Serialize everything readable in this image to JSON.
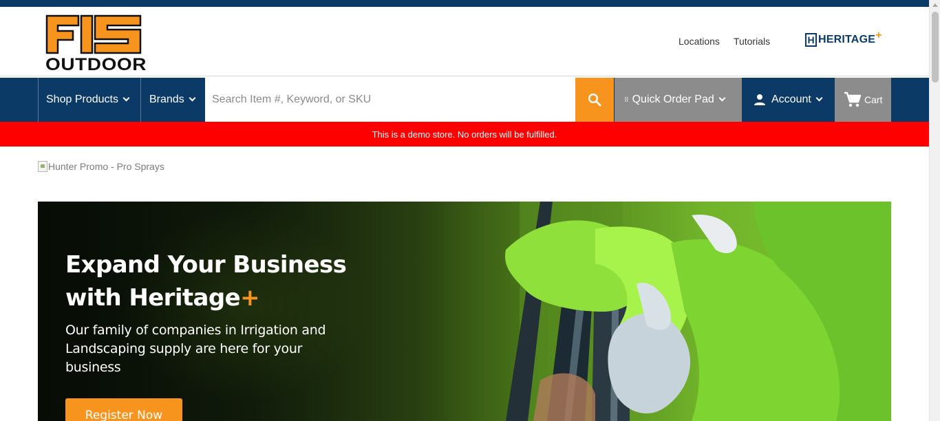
{
  "header": {
    "brand_logo_word": "FIS",
    "brand_logo_sub": "OUTDOOR",
    "top_links": [
      "Locations",
      "Tutorials"
    ],
    "partner_logo": {
      "word": "HERITAGE",
      "plus": "+"
    }
  },
  "nav": {
    "shop_products": "Shop Products",
    "brands": "Brands",
    "search": {
      "placeholder": "Search Item #, Keyword, or SKU",
      "value": ""
    },
    "quick_order_pad": "Quick Order Pad",
    "account": "Account",
    "cart": "Cart"
  },
  "notice": "This is a demo store. No orders will be fulfilled.",
  "promo_alt": "Hunter Promo - Pro Sprays",
  "hero": {
    "title_line1": "Expand Your Business",
    "title_line2": "with Heritage",
    "title_plus": "+",
    "subtitle": "Our family of companies in Irrigation and Landscaping supply are here for your business",
    "cta": "Register Now"
  },
  "colors": {
    "brand_navy": "#0b3a66",
    "accent_orange": "#f7941d",
    "notice_red": "#ff0000",
    "nav_gray": "#8c8c8c"
  },
  "icons": [
    "search-icon",
    "user-icon",
    "cart-icon",
    "chevron-down-icon",
    "grip-icon"
  ]
}
